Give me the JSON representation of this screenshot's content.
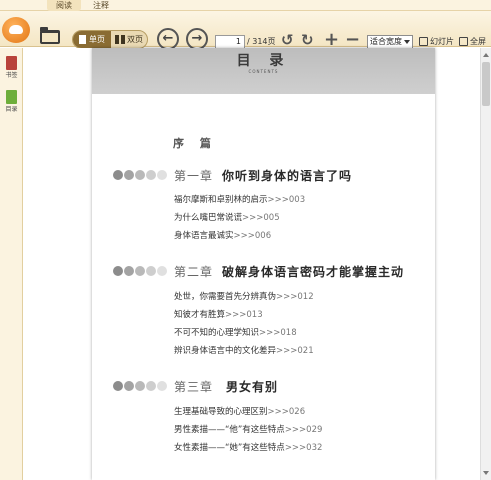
{
  "tabs": [
    {
      "label": "阅读",
      "active": true
    },
    {
      "label": "注释",
      "active": false
    }
  ],
  "toolbar": {
    "view_single": "单页",
    "view_double": "双页",
    "current_page": "1",
    "total_pages": "/ 314页",
    "zoom_mode": "适合宽度",
    "slideshow": "幻灯片",
    "fullscreen": "全屏"
  },
  "sidebar": {
    "bookmark": "书签",
    "toc": "目录"
  },
  "page": {
    "title": "目 录",
    "subtitle": "CONTENTS",
    "preface": "序 篇",
    "chapters": [
      {
        "number": "第一章",
        "title": "你听到身体的语言了吗",
        "entries": [
          {
            "text": "福尔摩斯和卓别林的启示",
            "page": ">>>003"
          },
          {
            "text": "为什么嘴巴常说谎",
            "page": ">>>005"
          },
          {
            "text": "身体语言最诚实",
            "page": ">>>006"
          }
        ]
      },
      {
        "number": "第二章",
        "title": "破解身体语言密码才能掌握主动",
        "entries": [
          {
            "text": "处世，你需要首先分辨真伪",
            "page": ">>>012"
          },
          {
            "text": "知彼才有胜算",
            "page": ">>>013"
          },
          {
            "text": "不可不知的心理学知识",
            "page": ">>>018"
          },
          {
            "text": "辨识身体语言中的文化差异",
            "page": ">>>021"
          }
        ]
      },
      {
        "number": "第三章",
        "title": "男女有别",
        "entries": [
          {
            "text": "生理基础导致的心理区别",
            "page": ">>>026"
          },
          {
            "text": "男性素描——“他”有这些特点",
            "page": ">>>029"
          },
          {
            "text": "女性素描——“她”有这些特点",
            "page": ">>>032"
          }
        ]
      }
    ]
  },
  "colors": {
    "toolbar_bg": "#f4e6c4",
    "accent": "#8a6c33",
    "dot_dark": "#8c8c8c",
    "dot_light": "#dedede"
  }
}
